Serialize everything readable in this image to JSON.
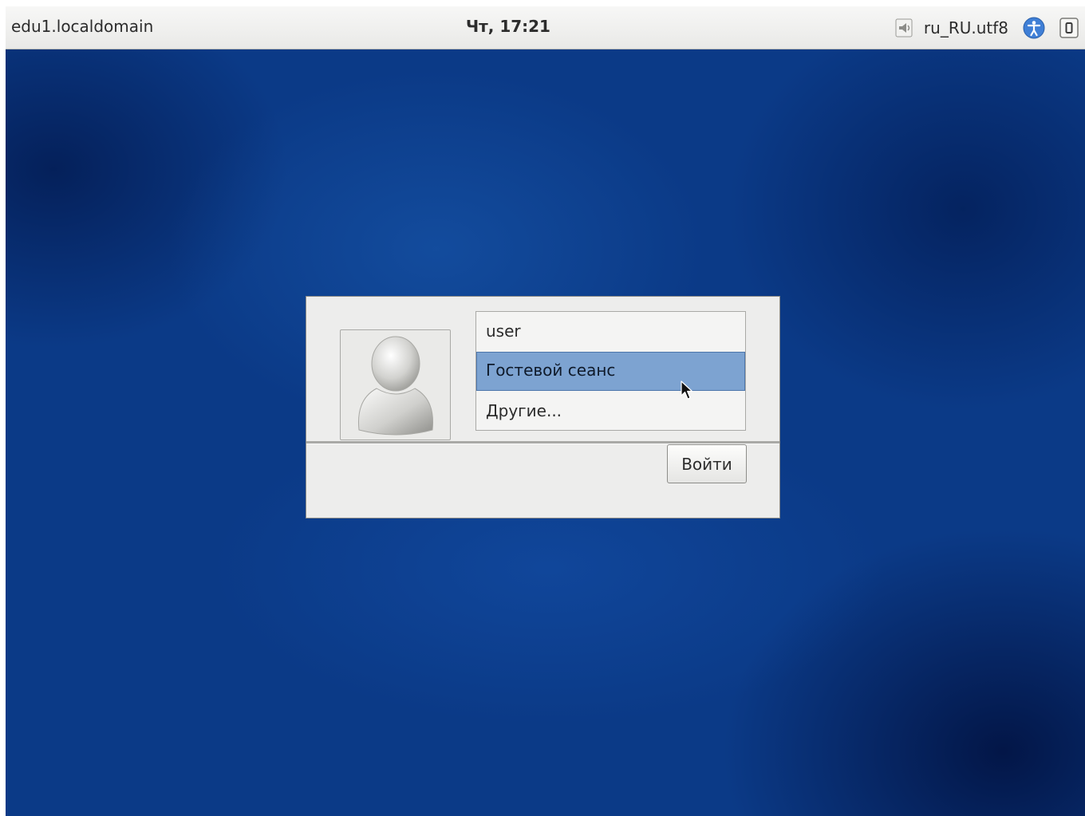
{
  "top_bar": {
    "hostname": "edu1.localdomain",
    "clock": "Чт, 17:21",
    "locale": "ru_RU.utf8",
    "icons": [
      "speaker-icon",
      "accessibility-icon",
      "power-icon"
    ]
  },
  "login": {
    "users": [
      {
        "label": "user",
        "selected": false
      },
      {
        "label": "Гостевой сеанс",
        "selected": true
      },
      {
        "label": "Другие...",
        "selected": false
      }
    ],
    "login_button": "Войти"
  },
  "colors": {
    "desktop_background": "#0b3a87",
    "selection": "#7da3d1",
    "dialog_background": "#ededec"
  }
}
